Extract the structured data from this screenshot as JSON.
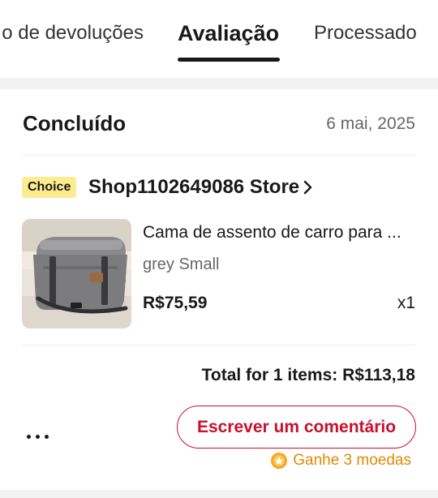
{
  "tabs": {
    "left_label": "o de devoluções",
    "active_label": "Avaliação",
    "right_label": "Processado"
  },
  "order": {
    "status": "Concluído",
    "date": "6 mai, 2025",
    "badge": "Choice",
    "store_name": "Shop1102649086 Store",
    "product": {
      "name": "Cama de assento de carro para ...",
      "variant": "grey Small",
      "price": "R$75,59",
      "quantity": "x1",
      "image_icon": "pet-car-seat-bed-image"
    },
    "total": "Total for 1 items: R$113,18",
    "review_button": "Escrever um comentário",
    "coins_label": "Ganhe 3 moedas"
  },
  "colors": {
    "accent": "#c8102e",
    "coins": "#e08a00",
    "badge_bg": "#fdeb8f"
  }
}
